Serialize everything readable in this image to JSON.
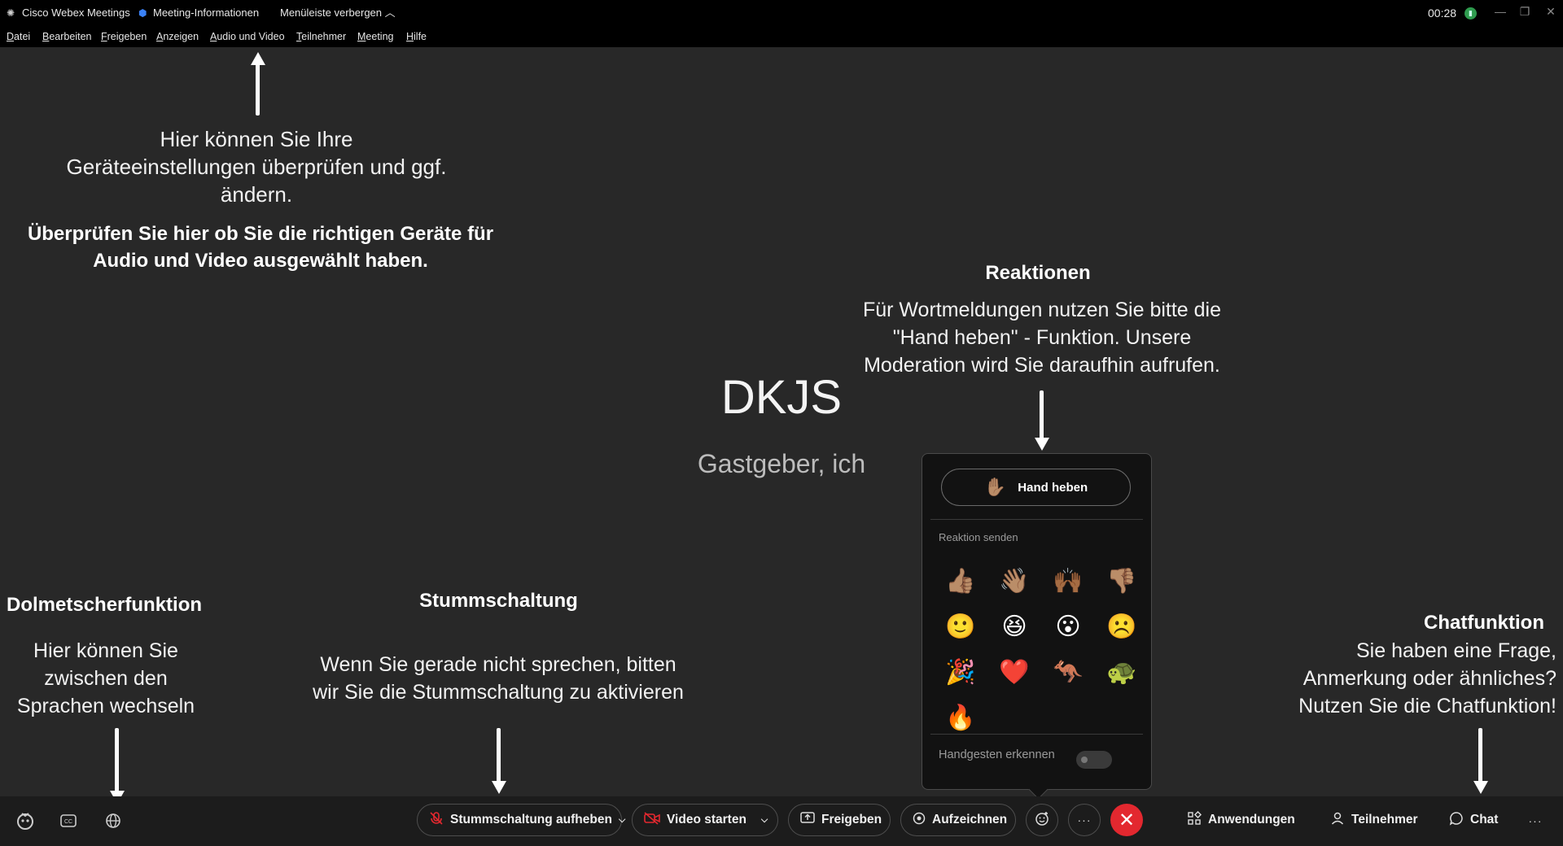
{
  "titlebar": {
    "app_name": "Cisco Webex Meetings",
    "meeting_info": "Meeting-Informationen",
    "hide_menu": "Menüleiste verbergen",
    "timer": "00:28"
  },
  "menubar": {
    "items": [
      "Datei",
      "Bearbeiten",
      "Freigeben",
      "Anzeigen",
      "Audio und Video",
      "Teilnehmer",
      "Meeting",
      "Hilfe"
    ]
  },
  "annotations": {
    "device_hint": "Hier können Sie Ihre\nGeräteeinstellungen überprüfen und ggf.\nändern.",
    "device_bold": "Überprüfen Sie hier ob  Sie die richtigen Geräte für\nAudio und Video ausgewählt haben.",
    "reactions_title": "Reaktionen",
    "reactions_text": "Für Wortmeldungen nutzen Sie bitte die\n\"Hand heben\" - Funktion. Unsere\nModeration wird Sie daraufhin aufrufen.",
    "interpreter_title": "Dolmetscherfunktion",
    "interpreter_text": "Hier können Sie\nzwischen den\nSprachen wechseln",
    "mute_title": "Stummschaltung",
    "mute_text": "Wenn Sie gerade nicht sprechen, bitten\nwir Sie die Stummschaltung zu aktivieren",
    "chat_title": "Chatfunktion",
    "chat_text": "Sie haben eine Frage,\nAnmerkung oder ähnliches?\nNutzen Sie die Chatfunktion!"
  },
  "center": {
    "name": "DKJS",
    "subtitle": "Gastgeber, ich"
  },
  "reactions_panel": {
    "raise_hand": "Hand heben",
    "send_label": "Reaktion senden",
    "emojis": [
      "👍🏽",
      "👋🏽",
      "🙌🏾",
      "👎🏽",
      "🙂",
      "😆",
      "😮",
      "☹️",
      "🎉",
      "❤️",
      "🦘",
      "🐢",
      "🔥"
    ],
    "gesture_label": "Handgesten erkennen"
  },
  "bottombar": {
    "unmute": "Stummschaltung aufheben",
    "start_video": "Video starten",
    "share": "Freigeben",
    "record": "Aufzeichnen",
    "apps": "Anwendungen",
    "participants": "Teilnehmer",
    "chat": "Chat"
  },
  "colors": {
    "background": "#282828",
    "bar": "#1c1c1c",
    "end_call": "#e3282f",
    "meeting_info_shield": "#3b82f6",
    "signal": "#2e9b4e"
  }
}
